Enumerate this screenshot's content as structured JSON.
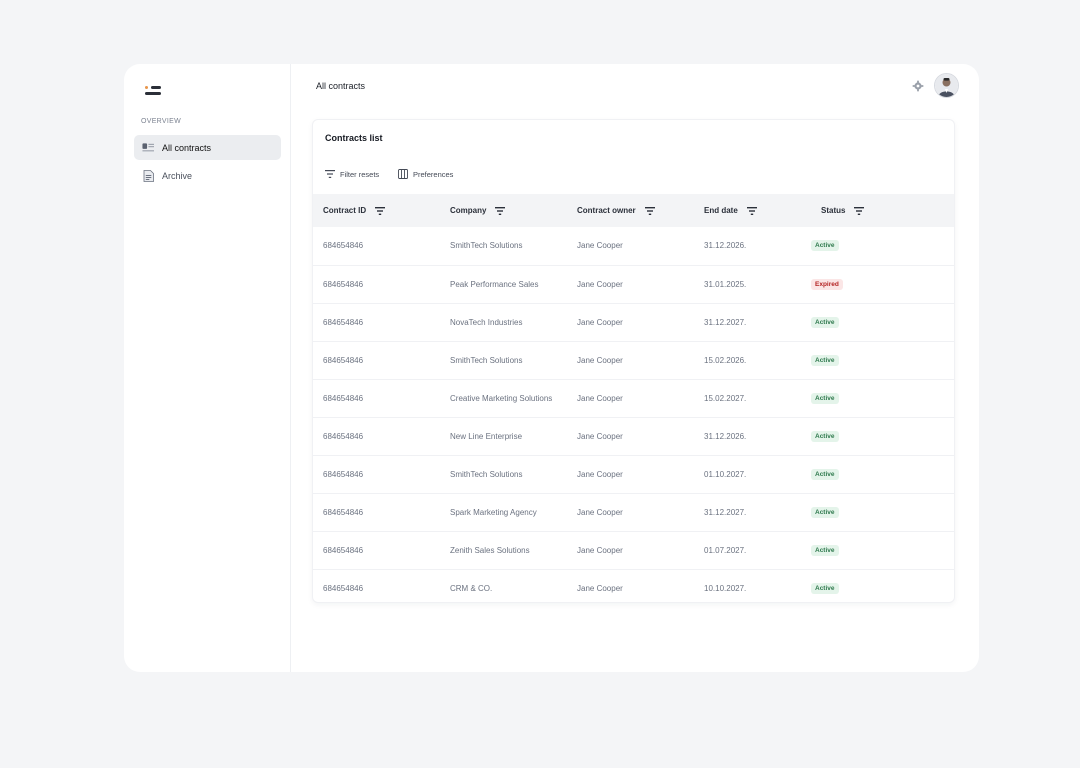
{
  "sidebar": {
    "section_title": "OVERVIEW",
    "items": [
      {
        "label": "All contracts",
        "icon": "contracts-icon",
        "active": true
      },
      {
        "label": "Archive",
        "icon": "archive-icon",
        "active": false
      }
    ]
  },
  "header": {
    "title": "All contracts",
    "settings_icon": "gear-icon",
    "avatar": "user-avatar"
  },
  "card": {
    "title": "Contracts list",
    "filter_resets_label": "Filter resets",
    "preferences_label": "Preferences"
  },
  "table": {
    "columns": [
      "Contract ID",
      "Company",
      "Contract owner",
      "End date",
      "Status"
    ],
    "rows": [
      {
        "id": "684654846",
        "company": "SmithTech Solutions",
        "owner": "Jane Cooper",
        "end_date": "31.12.2026.",
        "status": "Active"
      },
      {
        "id": "684654846",
        "company": "Peak Performance Sales",
        "owner": "Jane Cooper",
        "end_date": "31.01.2025.",
        "status": "Expired"
      },
      {
        "id": "684654846",
        "company": "NovaTech Industries",
        "owner": "Jane Cooper",
        "end_date": "31.12.2027.",
        "status": "Active"
      },
      {
        "id": "684654846",
        "company": "SmithTech Solutions",
        "owner": "Jane Cooper",
        "end_date": "15.02.2026.",
        "status": "Active"
      },
      {
        "id": "684654846",
        "company": "Creative Marketing Solutions",
        "owner": "Jane Cooper",
        "end_date": "15.02.2027.",
        "status": "Active"
      },
      {
        "id": "684654846",
        "company": "New Line Enterprise",
        "owner": "Jane Cooper",
        "end_date": "31.12.2026.",
        "status": "Active"
      },
      {
        "id": "684654846",
        "company": "SmithTech Solutions",
        "owner": "Jane Cooper",
        "end_date": "01.10.2027.",
        "status": "Active"
      },
      {
        "id": "684654846",
        "company": "Spark Marketing Agency",
        "owner": "Jane Cooper",
        "end_date": "31.12.2027.",
        "status": "Active"
      },
      {
        "id": "684654846",
        "company": "Zenith Sales Solutions",
        "owner": "Jane Cooper",
        "end_date": "01.07.2027.",
        "status": "Active"
      },
      {
        "id": "684654846",
        "company": "CRM & CO.",
        "owner": "Jane Cooper",
        "end_date": "10.10.2027.",
        "status": "Active"
      }
    ]
  },
  "colors": {
    "active_bg": "#e4f4ea",
    "active_text": "#2f7a4e",
    "expired_bg": "#fbe6e6",
    "expired_text": "#b42323"
  }
}
